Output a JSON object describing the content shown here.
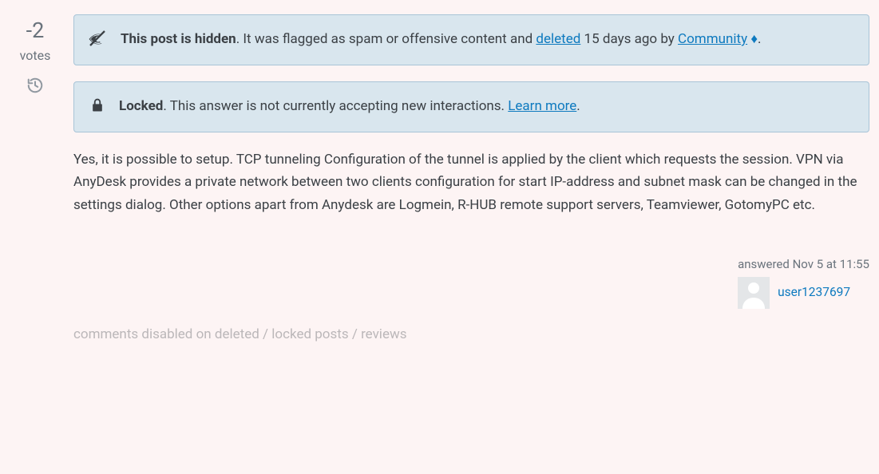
{
  "vote": {
    "score": "-2",
    "label": "votes"
  },
  "notice_hidden": {
    "lead_bold": "This post is hidden",
    "before_deleted": ". It was flagged as spam or offensive content and ",
    "deleted_link": "deleted",
    "after_deleted": " 15 days ago by ",
    "community_link": "Community",
    "diamond": " ♦",
    "tail": "."
  },
  "notice_locked": {
    "lead_bold": "Locked",
    "text": ". This answer is not currently accepting new interactions. ",
    "learn_link": "Learn more",
    "tail": "."
  },
  "body": "Yes, it is possible to setup. TCP tunneling Configuration of the tunnel is applied by the client which requests the session. VPN via AnyDesk provides a private network between two clients configuration for start IP-address and subnet mask can be changed in the settings dialog. Other options apart from Anydesk are Logmein, R-HUB remote support servers, Teamviewer, GotomyPC etc.",
  "usercard": {
    "answered": "answered Nov 5 at 11:55",
    "username": "user1237697"
  },
  "comments_note": "comments disabled on deleted / locked posts / reviews"
}
